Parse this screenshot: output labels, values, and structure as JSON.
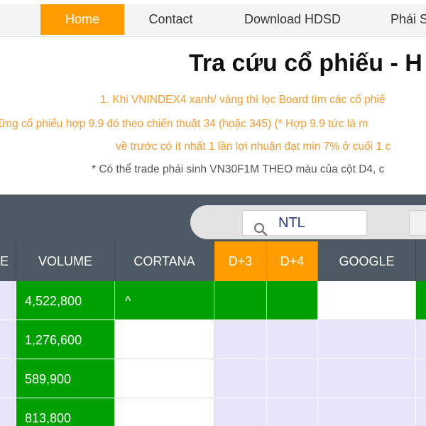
{
  "nav": {
    "items": [
      {
        "label": "Home",
        "active": true
      },
      {
        "label": "Contact",
        "active": false
      },
      {
        "label": "Download HDSD",
        "active": false
      },
      {
        "label": "Phái S",
        "active": false
      }
    ]
  },
  "hero": {
    "title": "Tra cứu cổ phiếu - H",
    "notes": [
      "1. Khi VNINDEX4 xanh/ vàng thì lọc Board tìm các cổ phiế",
      "ững cổ phiếu hợp 9.9 đó theo chiến thuật 34 (hoặc 345) (* Hợp 9.9 tức là m",
      "về trước có ít nhất 1 lần lợi nhuận đạt min 7% ở cuối 1 c",
      "* Có thể trade phái sinh VN30F1M THEO màu của cột D4, c"
    ]
  },
  "search": {
    "value": "NTL"
  },
  "table": {
    "headers": [
      "E",
      "VOLUME",
      "CORTANA",
      "D+3",
      "D+4",
      "GOOGLE",
      ""
    ],
    "volume": [
      "4,522,800",
      "1,276,600",
      "589,900",
      "813,800"
    ],
    "cortana_row1": "^"
  },
  "colors": {
    "accent": "#ff9c00",
    "header_dark": "#4d5a63",
    "green": "#00a000",
    "lavender": "#e8e5fb",
    "note_orange": "#f39b32"
  }
}
